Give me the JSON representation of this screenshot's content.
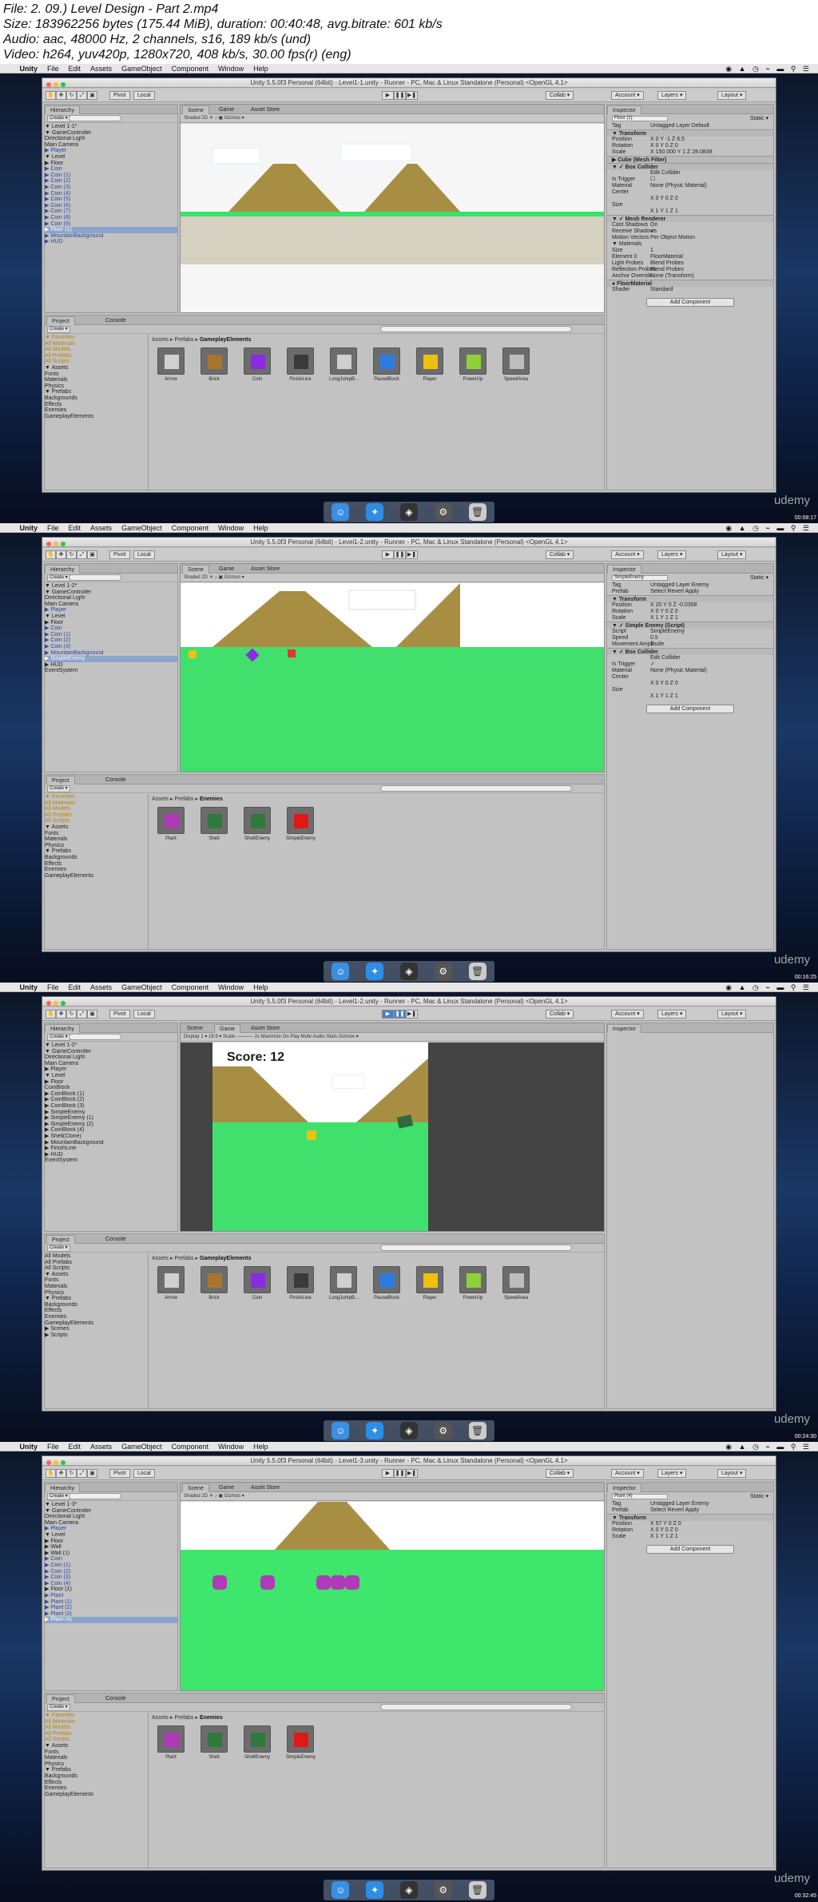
{
  "header": {
    "file": "File: 2. 09.) Level Design - Part 2.mp4",
    "size": "Size: 183962256 bytes (175.44 MiB), duration: 00:40:48, avg.bitrate: 601 kb/s",
    "audio": "Audio: aac, 48000 Hz, 2 channels, s16, 189 kb/s (und)",
    "video": "Video: h264, yuv420p, 1280x720, 408 kb/s, 30.00 fps(r) (eng)"
  },
  "menubar": {
    "app": "Unity",
    "items": [
      "File",
      "Edit",
      "Assets",
      "GameObject",
      "Component",
      "Window",
      "Help"
    ]
  },
  "toolbar": {
    "pivot": "Pivot",
    "local": "Local",
    "collab": "Collab ▾",
    "account": "Account ▾",
    "layers": "Layers ▾",
    "layout": "Layout ▾"
  },
  "watermark": "udemy",
  "frames": [
    {
      "title": "Unity 5.5.0f3 Personal (64bit) - Level1-1.unity - Runner - PC, Mac & Linux Standalone (Personal) <OpenGL 4.1>",
      "timestamp": "00:08:17",
      "tabs": {
        "left": "Hierarchy",
        "scene": "Scene",
        "game": "Game",
        "store": "Asset Store",
        "inspector": "Inspector",
        "project": "Project",
        "console": "Console"
      },
      "scene_ctl": "Shaded   2D   ☀  ♪  ▣         Gizmos ▾",
      "hierarchy": [
        {
          "t": "▼ Level 1-1*",
          "c": ""
        },
        {
          "t": "  ▼ GameController",
          "c": ""
        },
        {
          "t": "     Directional Light",
          "c": ""
        },
        {
          "t": "     Main Camera",
          "c": ""
        },
        {
          "t": "   ▶ Player",
          "c": "blue"
        },
        {
          "t": "   ▼ Level",
          "c": ""
        },
        {
          "t": "      ▶ Floor",
          "c": ""
        },
        {
          "t": "      ▶ Coin",
          "c": "blue"
        },
        {
          "t": "      ▶ Coin (1)",
          "c": "blue"
        },
        {
          "t": "      ▶ Coin (2)",
          "c": "blue"
        },
        {
          "t": "      ▶ Coin (3)",
          "c": "blue"
        },
        {
          "t": "      ▶ Coin (4)",
          "c": "blue"
        },
        {
          "t": "      ▶ Coin (5)",
          "c": "blue"
        },
        {
          "t": "      ▶ Coin (6)",
          "c": "blue"
        },
        {
          "t": "      ▶ Coin (7)",
          "c": "blue"
        },
        {
          "t": "      ▶ Coin (8)",
          "c": "blue"
        },
        {
          "t": "      ▶ Coin (9)",
          "c": "blue"
        },
        {
          "t": "      ▶ Floor (1)",
          "c": "sel"
        },
        {
          "t": "   ▶ MountainBackground",
          "c": "blue"
        },
        {
          "t": "   ▶ HUD",
          "c": "blue"
        }
      ],
      "crumb": "Assets ▸ Prefabs ▸ ",
      "crumb_last": "GameplayElements",
      "project_tree": [
        "▼ Favorites",
        "   All Materials",
        "   All Models",
        "   All Prefabs",
        "   All Scripts",
        "",
        "▼ Assets",
        "   Fonts",
        "   Materials",
        "   Physics",
        "  ▼ Prefabs",
        "     Backgrounds",
        "     Effects",
        "     Enemies",
        "     GameplayElements"
      ],
      "assets": [
        {
          "name": "Arrow",
          "color": "#d0d0d0"
        },
        {
          "name": "Brick",
          "color": "#a8742e"
        },
        {
          "name": "Coin",
          "color": "#8a2be2"
        },
        {
          "name": "FinishLine",
          "color": "#3a3a3a"
        },
        {
          "name": "LongJumpB...",
          "color": "#cfcfcf"
        },
        {
          "name": "PauseBlock",
          "color": "#2d7be0"
        },
        {
          "name": "Player",
          "color": "#f0c010"
        },
        {
          "name": "PowerUp",
          "color": "#8fd13a"
        },
        {
          "name": "SpeedArea",
          "color": "#bdbdbd"
        }
      ],
      "inspector": [
        {
          "type": "obj",
          "text": "Floor (1)",
          "extra": "Static ▾"
        },
        {
          "type": "row",
          "k": "Tag",
          "v": "Untagged   Layer  Default"
        },
        {
          "type": "sect",
          "text": "▼ Transform"
        },
        {
          "type": "row",
          "k": "Position",
          "v": "X 0    Y -1    Z 6.5"
        },
        {
          "type": "row",
          "k": "Rotation",
          "v": "X 0    Y 0    Z 0"
        },
        {
          "type": "row",
          "k": "Scale",
          "v": "X 150.000  Y 1   Z 28.0838"
        },
        {
          "type": "sect",
          "text": "▶ Cube (Mesh Filter)"
        },
        {
          "type": "sect",
          "text": "▼ ✓ Box Collider"
        },
        {
          "type": "row",
          "k": "",
          "v": "Edit Collider"
        },
        {
          "type": "row",
          "k": "Is Trigger",
          "v": "☐"
        },
        {
          "type": "row",
          "k": "Material",
          "v": "None (Physic Material)"
        },
        {
          "type": "row",
          "k": "Center",
          "v": ""
        },
        {
          "type": "row",
          "k": "",
          "v": "X 0    Y 0    Z 0"
        },
        {
          "type": "row",
          "k": "Size",
          "v": ""
        },
        {
          "type": "row",
          "k": "",
          "v": "X 1    Y 1    Z 1"
        },
        {
          "type": "sect",
          "text": "▼ ✓ Mesh Renderer"
        },
        {
          "type": "row",
          "k": "Cast Shadows",
          "v": "On"
        },
        {
          "type": "row",
          "k": "Receive Shadows",
          "v": "✓"
        },
        {
          "type": "row",
          "k": "Motion Vectors",
          "v": "Per Object Motion"
        },
        {
          "type": "row",
          "k": "▼ Materials",
          "v": ""
        },
        {
          "type": "row",
          "k": "  Size",
          "v": "1"
        },
        {
          "type": "row",
          "k": "  Element 0",
          "v": "FloorMaterial"
        },
        {
          "type": "row",
          "k": "Light Probes",
          "v": "Blend Probes"
        },
        {
          "type": "row",
          "k": "Reflection Probes",
          "v": "Blend Probes"
        },
        {
          "type": "row",
          "k": "Anchor Override",
          "v": "None (Transform)"
        },
        {
          "type": "sect",
          "text": "● FloorMaterial"
        },
        {
          "type": "row",
          "k": "  Shader",
          "v": "Standard"
        }
      ],
      "add_component": "Add Component"
    },
    {
      "title": "Unity 5.5.0f3 Personal (64bit) - Level1-2.unity - Runner - PC, Mac & Linux Standalone (Personal) <OpenGL 4.1>",
      "timestamp": "00:16:25",
      "tabs": {
        "left": "Hierarchy",
        "scene": "Scene",
        "game": "Game",
        "store": "Asset Store",
        "inspector": "Inspector",
        "project": "Project",
        "console": "Console"
      },
      "scene_ctl": "Shaded   2D   ☀  ♪  ▣         Gizmos ▾",
      "hierarchy": [
        {
          "t": "▼ Level 1-2*",
          "c": ""
        },
        {
          "t": "  ▼ GameController",
          "c": ""
        },
        {
          "t": "     Directional Light",
          "c": ""
        },
        {
          "t": "     Main Camera",
          "c": ""
        },
        {
          "t": "   ▶ Player",
          "c": "blue"
        },
        {
          "t": "   ▼ Level",
          "c": ""
        },
        {
          "t": "      ▶ Floor",
          "c": ""
        },
        {
          "t": "      ▶ Coin",
          "c": "blue"
        },
        {
          "t": "      ▶ Coin (1)",
          "c": "blue"
        },
        {
          "t": "      ▶ Coin (2)",
          "c": "blue"
        },
        {
          "t": "      ▶ Coin (3)",
          "c": "blue"
        },
        {
          "t": "   ▶ MountainBackground",
          "c": "blue"
        },
        {
          "t": "   ▶ SimpleEnemy",
          "c": "sel"
        },
        {
          "t": "   ▶ HUD",
          "c": ""
        },
        {
          "t": "     EventSystem",
          "c": ""
        }
      ],
      "crumb": "Assets ▸ Prefabs ▸ ",
      "crumb_last": "Enemies",
      "project_tree": [
        "▼ Favorites",
        "   All Materials",
        "   All Models",
        "   All Prefabs",
        "   All Scripts",
        "",
        "▼ Assets",
        "   Fonts",
        "   Materials",
        "   Physics",
        "  ▼ Prefabs",
        "     Backgrounds",
        "     Effects",
        "     Enemies",
        "     GameplayElements"
      ],
      "assets": [
        {
          "name": "Plant",
          "color": "#b03ab8"
        },
        {
          "name": "Shell",
          "color": "#2f7a3a"
        },
        {
          "name": "ShellEnemy",
          "color": "#2f7a3a"
        },
        {
          "name": "SimpleEnemy",
          "color": "#e01818"
        }
      ],
      "inspector": [
        {
          "type": "obj",
          "text": "SimpleEnemy",
          "extra": "Static ▾"
        },
        {
          "type": "row",
          "k": "Tag",
          "v": "Untagged   Layer  Enemy"
        },
        {
          "type": "row",
          "k": "Prefab",
          "v": "Select   Revert   Apply"
        },
        {
          "type": "sect",
          "text": "▼ Transform"
        },
        {
          "type": "row",
          "k": "Position",
          "v": "X 20   Y 0    Z -0.0358"
        },
        {
          "type": "row",
          "k": "Rotation",
          "v": "X 0    Y 0    Z 0"
        },
        {
          "type": "row",
          "k": "Scale",
          "v": "X 1    Y 1    Z 1"
        },
        {
          "type": "sect",
          "text": "▼ ✓ Simple Enemy (Script)"
        },
        {
          "type": "row",
          "k": "Script",
          "v": "SimpleEnemy"
        },
        {
          "type": "row",
          "k": "Speed",
          "v": "0.5"
        },
        {
          "type": "row",
          "k": "Movement Amplitude",
          "v": "1"
        },
        {
          "type": "sect",
          "text": "▼ ✓ Box Collider"
        },
        {
          "type": "row",
          "k": "",
          "v": "Edit Collider"
        },
        {
          "type": "row",
          "k": "Is Trigger",
          "v": "✓"
        },
        {
          "type": "row",
          "k": "Material",
          "v": "None (Physic Material)"
        },
        {
          "type": "row",
          "k": "Center",
          "v": ""
        },
        {
          "type": "row",
          "k": "",
          "v": "X 0    Y 0    Z 0"
        },
        {
          "type": "row",
          "k": "Size",
          "v": ""
        },
        {
          "type": "row",
          "k": "",
          "v": "X 1    Y 1    Z 1"
        }
      ],
      "add_component": "Add Component"
    },
    {
      "title": "Unity 5.5.0f3 Personal (64bit) - Level1-2.unity - Runner - PC, Mac & Linux Standalone (Personal) <OpenGL 4.1>",
      "timestamp": "00:24:30",
      "tabs": {
        "left": "Hierarchy",
        "scene": "Scene",
        "game": "Game",
        "store": "Asset Store",
        "inspector": "Inspector",
        "project": "Project",
        "console": "Console"
      },
      "scene_ctl": "Display 1 ▾   16:9 ▾   Scale ───── 2x     Maximize On Play  Mute Audio  Stats  Gizmos ▾",
      "score": "Score: 12",
      "hierarchy": [
        {
          "t": "▼ Level 1-2*",
          "c": ""
        },
        {
          "t": "  ▼ GameController",
          "c": ""
        },
        {
          "t": "     Directional Light",
          "c": ""
        },
        {
          "t": "     Main Camera",
          "c": ""
        },
        {
          "t": "   ▶ Player",
          "c": ""
        },
        {
          "t": "   ▼ Level",
          "c": ""
        },
        {
          "t": "      ▶ Floor",
          "c": ""
        },
        {
          "t": "        CoinBlock",
          "c": ""
        },
        {
          "t": "      ▶ CoinBlock (1)",
          "c": ""
        },
        {
          "t": "      ▶ CoinBlock (2)",
          "c": ""
        },
        {
          "t": "      ▶ CoinBlock (3)",
          "c": ""
        },
        {
          "t": "      ▶ SimpleEnemy",
          "c": ""
        },
        {
          "t": "      ▶ SimpleEnemy (1)",
          "c": ""
        },
        {
          "t": "      ▶ SimpleEnemy (2)",
          "c": ""
        },
        {
          "t": "      ▶ CoinBlock (4)",
          "c": ""
        },
        {
          "t": "      ▶ Shell(Clone)",
          "c": ""
        },
        {
          "t": "   ▶ MountainBackground",
          "c": ""
        },
        {
          "t": "   ▶ FinishLine",
          "c": ""
        },
        {
          "t": "   ▶ HUD",
          "c": ""
        },
        {
          "t": "     EventSystem",
          "c": ""
        }
      ],
      "crumb": "Assets ▸ Prefabs ▸ ",
      "crumb_last": "GameplayElements",
      "project_tree": [
        "   All Models",
        "   All Prefabs",
        "   All Scripts",
        "",
        "▼ Assets",
        "   Fonts",
        "   Materials",
        "   Physics",
        "  ▼ Prefabs",
        "     Backgrounds",
        "     Effects",
        "     Enemies",
        "     GameplayElements",
        "   ▶ Scenes",
        "   ▶ Scripts"
      ],
      "assets": [
        {
          "name": "Arrow",
          "color": "#d0d0d0"
        },
        {
          "name": "Brick",
          "color": "#a8742e"
        },
        {
          "name": "Coin",
          "color": "#8a2be2"
        },
        {
          "name": "FinishLine",
          "color": "#3a3a3a"
        },
        {
          "name": "LongJumpB...",
          "color": "#cfcfcf"
        },
        {
          "name": "PauseBlock",
          "color": "#2d7be0"
        },
        {
          "name": "Player",
          "color": "#f0c010"
        },
        {
          "name": "PowerUp",
          "color": "#8fd13a"
        },
        {
          "name": "SpeedArea",
          "color": "#bdbdbd"
        }
      ],
      "inspector": [],
      "add_component": ""
    },
    {
      "title": "Unity 5.5.0f3 Personal (64bit) - Level1-3.unity - Runner - PC, Mac & Linux Standalone (Personal) <OpenGL 4.1>",
      "timestamp": "00:32:45",
      "tabs": {
        "left": "Hierarchy",
        "scene": "Scene",
        "game": "Game",
        "store": "Asset Store",
        "inspector": "Inspector",
        "project": "Project",
        "console": "Console"
      },
      "scene_ctl": "Shaded   2D   ☀  ♪  ▣         Gizmos ▾",
      "hierarchy": [
        {
          "t": "▼ Level 1-3*",
          "c": ""
        },
        {
          "t": "  ▼ GameController",
          "c": ""
        },
        {
          "t": "     Directional Light",
          "c": ""
        },
        {
          "t": "     Main Camera",
          "c": ""
        },
        {
          "t": "   ▶ Player",
          "c": "blue"
        },
        {
          "t": "   ▼ Level",
          "c": ""
        },
        {
          "t": "      ▶ Floor",
          "c": ""
        },
        {
          "t": "      ▶ Wall",
          "c": ""
        },
        {
          "t": "      ▶ Wall (1)",
          "c": ""
        },
        {
          "t": "      ▶ Coin",
          "c": "blue"
        },
        {
          "t": "      ▶ Coin (1)",
          "c": "blue"
        },
        {
          "t": "      ▶ Coin (2)",
          "c": "blue"
        },
        {
          "t": "      ▶ Coin (3)",
          "c": "blue"
        },
        {
          "t": "      ▶ Coin (4)",
          "c": "blue"
        },
        {
          "t": "      ▶ Floor (1)",
          "c": ""
        },
        {
          "t": "      ▶ Plant",
          "c": "blue"
        },
        {
          "t": "      ▶ Plant (1)",
          "c": "blue"
        },
        {
          "t": "      ▶ Plant (2)",
          "c": "blue"
        },
        {
          "t": "      ▶ Plant (3)",
          "c": "blue"
        },
        {
          "t": "      ▶ Plant (4)",
          "c": "sel"
        }
      ],
      "crumb": "Assets ▸ Prefabs ▸ ",
      "crumb_last": "Enemies",
      "project_tree": [
        "▼ Favorites",
        "   All Materials",
        "   All Models",
        "   All Prefabs",
        "   All Scripts",
        "",
        "▼ Assets",
        "   Fonts",
        "   Materials",
        "   Physics",
        "  ▼ Prefabs",
        "     Backgrounds",
        "     Effects",
        "     Enemies",
        "     GameplayElements"
      ],
      "assets": [
        {
          "name": "Plant",
          "color": "#b03ab8"
        },
        {
          "name": "Shell",
          "color": "#2f7a3a"
        },
        {
          "name": "ShellEnemy",
          "color": "#2f7a3a"
        },
        {
          "name": "SimpleEnemy",
          "color": "#e01818"
        }
      ],
      "inspector": [
        {
          "type": "obj",
          "text": "Plant (4)",
          "extra": "Static ▾"
        },
        {
          "type": "row",
          "k": "Tag",
          "v": "Untagged   Layer  Enemy"
        },
        {
          "type": "row",
          "k": "Prefab",
          "v": "Select   Revert   Apply"
        },
        {
          "type": "sect",
          "text": "▼ Transform"
        },
        {
          "type": "row",
          "k": "Position",
          "v": "X 57   Y 0    Z 0"
        },
        {
          "type": "row",
          "k": "Rotation",
          "v": "X 0    Y 0    Z 0"
        },
        {
          "type": "row",
          "k": "Scale",
          "v": "X 1    Y 1    Z 1"
        }
      ],
      "add_component": "Add Component"
    }
  ]
}
